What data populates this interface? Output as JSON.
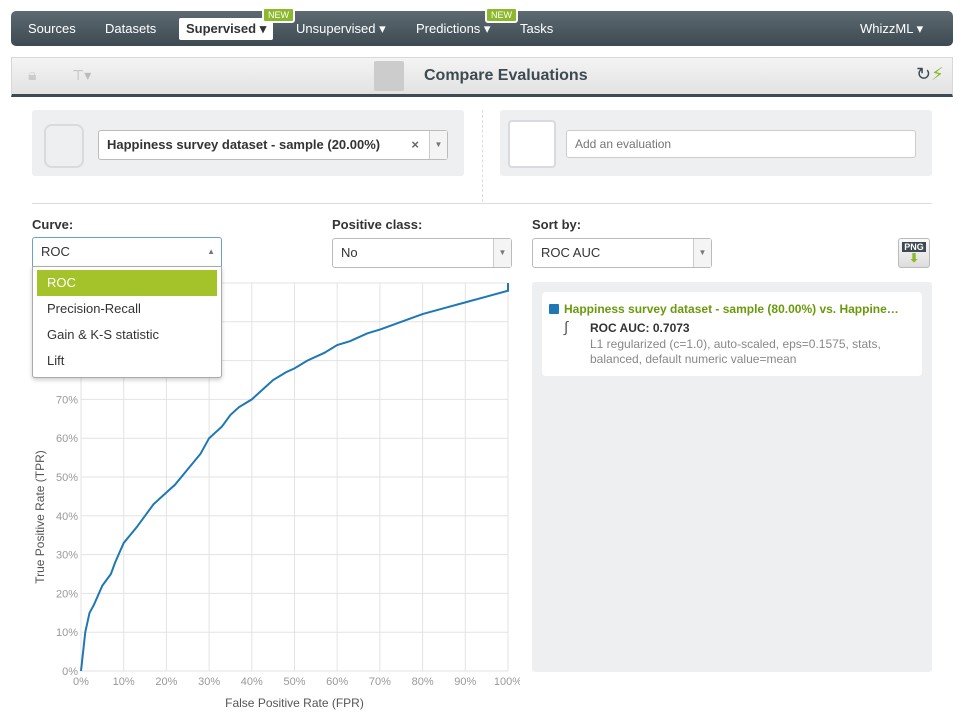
{
  "nav": {
    "items": [
      "Sources",
      "Datasets",
      "Supervised",
      "Unsupervised",
      "Predictions",
      "Tasks"
    ],
    "badge": "NEW",
    "right": "WhizzML"
  },
  "toolbar": {
    "title": "Compare Evaluations"
  },
  "dataset_select": {
    "value": "Happiness survey dataset - sample (20.00%)"
  },
  "evaluation_input": {
    "placeholder": "Add an evaluation"
  },
  "curve": {
    "label": "Curve:",
    "value": "ROC",
    "options": [
      "ROC",
      "Precision-Recall",
      "Gain & K-S statistic",
      "Lift"
    ]
  },
  "positive_class": {
    "label": "Positive class:",
    "value": "No"
  },
  "sort_by": {
    "label": "Sort by:",
    "value": "ROC AUC"
  },
  "png_button": "PNG",
  "legend": {
    "name": "Happiness survey dataset - sample (80.00%) vs. Happine…",
    "metric": "ROC AUC: 0.7073",
    "details": "L1 regularized (c=1.0), auto-scaled, eps=0.1575, stats, balanced, default numeric value=mean",
    "color": "#1f77b4"
  },
  "chart_data": {
    "type": "line",
    "xlabel": "False Positive Rate (FPR)",
    "ylabel": "True Positive Rate (TPR)",
    "xlim": [
      0,
      100
    ],
    "ylim": [
      0,
      100
    ],
    "grid": true,
    "xticks": [
      "0%",
      "10%",
      "20%",
      "30%",
      "40%",
      "50%",
      "60%",
      "70%",
      "80%",
      "90%",
      "100%"
    ],
    "yticks": [
      "0%",
      "10%",
      "20%",
      "30%",
      "40%",
      "50%",
      "60%",
      "70%"
    ],
    "series": [
      {
        "color": "#1f77b4",
        "x": [
          0,
          0.5,
          1,
          2,
          3,
          5,
          7,
          8,
          10,
          13,
          15,
          17,
          20,
          22,
          25,
          28,
          30,
          33,
          35,
          37,
          40,
          43,
          45,
          48,
          50,
          53,
          57,
          60,
          63,
          67,
          70,
          75,
          80,
          85,
          90,
          95,
          100,
          100
        ],
        "y": [
          0,
          5,
          10,
          15,
          17,
          22,
          25,
          28,
          33,
          37,
          40,
          43,
          46,
          48,
          52,
          56,
          60,
          63,
          66,
          68,
          70,
          73,
          75,
          77,
          78,
          80,
          82,
          84,
          85,
          87,
          88,
          90,
          92,
          93.5,
          95,
          96.5,
          98,
          100
        ]
      }
    ]
  }
}
